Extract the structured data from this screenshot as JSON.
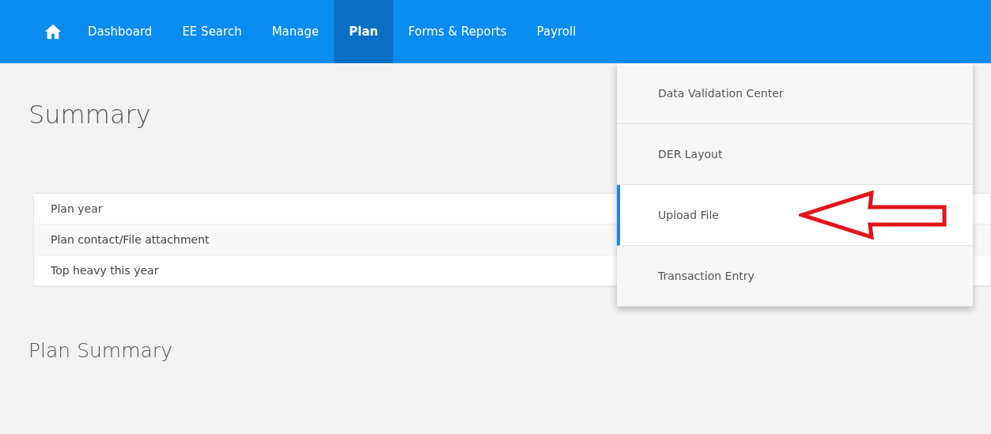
{
  "nav": {
    "items": [
      {
        "label": "Dashboard",
        "selected": false
      },
      {
        "label": "EE Search",
        "selected": false
      },
      {
        "label": "Manage",
        "selected": false
      },
      {
        "label": "Plan",
        "selected": true
      },
      {
        "label": "Forms & Reports",
        "selected": false
      },
      {
        "label": "Payroll",
        "selected": false
      }
    ]
  },
  "heading": "Summary",
  "summary_rows": [
    {
      "label": "Plan year"
    },
    {
      "label": "Plan contact/File attachment"
    },
    {
      "label": "Top heavy this year"
    }
  ],
  "section_heading": "Plan Summary",
  "dropdown": {
    "items": [
      {
        "label": "Data Validation Center",
        "selected": false
      },
      {
        "label": "DER Layout",
        "selected": false
      },
      {
        "label": "Upload File",
        "selected": true
      },
      {
        "label": "Transaction Entry",
        "selected": false
      }
    ]
  }
}
